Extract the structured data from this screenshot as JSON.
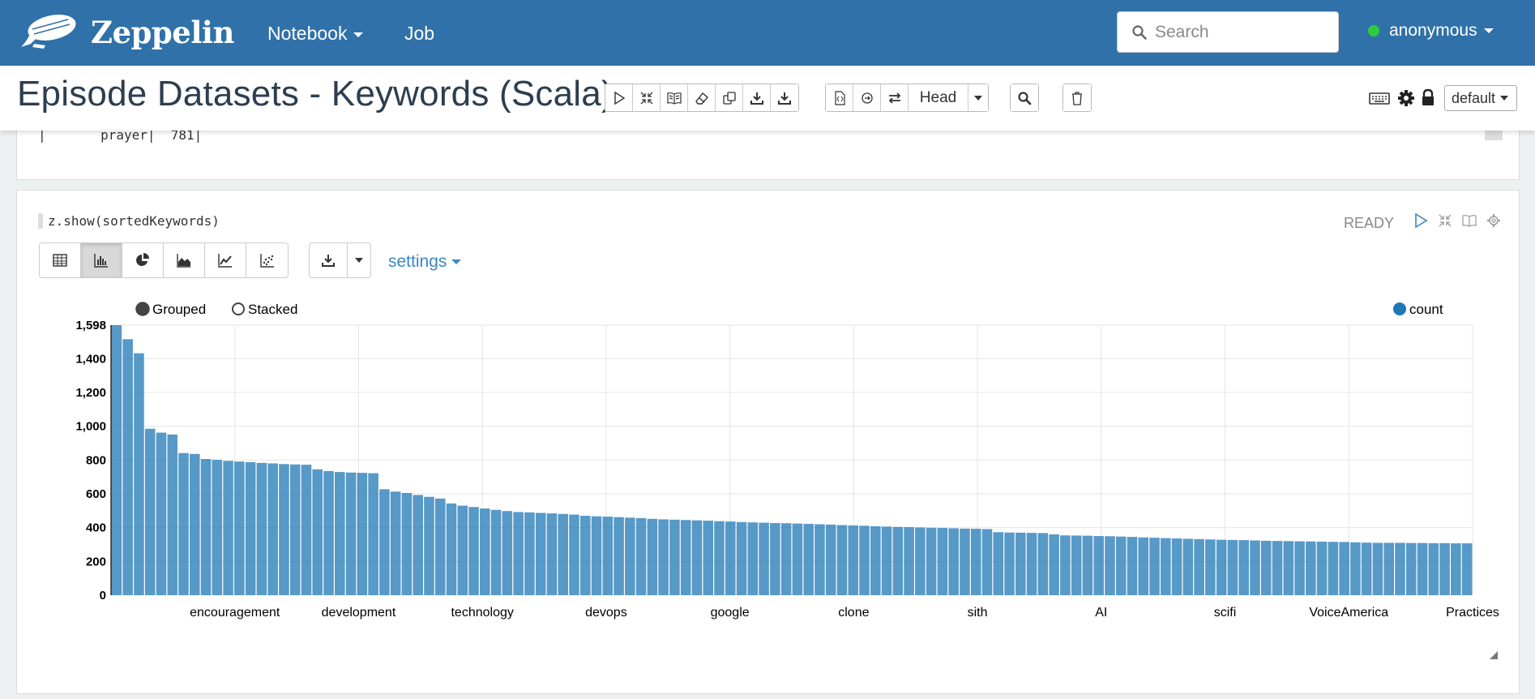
{
  "navbar": {
    "brand": "Zeppelin",
    "menu": [
      {
        "label": "Notebook",
        "dropdown": true
      },
      {
        "label": "Job",
        "dropdown": false
      }
    ],
    "search_placeholder": "Search",
    "user": "anonymous",
    "user_status_color": "#2ecc40",
    "bg_color": "#3071a9"
  },
  "note": {
    "title": "Episode Datasets - Keywords (Scala)",
    "head_label": "Head",
    "interpreter_binding": "default",
    "icons": [
      "run-all-icon",
      "collapse-icon",
      "book-icon",
      "eraser-icon",
      "clone-icon",
      "export-icon",
      "export-ipynb-icon",
      "version-control-icon",
      "commit-icon",
      "swap-icon",
      "search-icon",
      "trash-icon",
      "keyboard-icon",
      "gear-icon",
      "lock-icon"
    ]
  },
  "paragraph1": {
    "output_line": "|       prayer|  781|"
  },
  "paragraph2": {
    "code": "z.show(sortedKeywords)",
    "status": "READY",
    "viz_buttons": [
      "table-icon",
      "bar-chart-icon",
      "pie-chart-icon",
      "area-chart-icon",
      "line-chart-icon",
      "scatter-chart-icon"
    ],
    "active_viz": "bar-chart-icon",
    "settings_label": "settings"
  },
  "chart_data": {
    "type": "bar",
    "legend_modes": [
      "Grouped",
      "Stacked"
    ],
    "selected_mode": "Grouped",
    "series": [
      {
        "name": "count",
        "color": "#1f77b4",
        "values": [
          1598,
          1515,
          1432,
          985,
          962,
          951,
          841,
          836,
          806,
          801,
          795,
          791,
          787,
          783,
          780,
          776,
          774,
          772,
          745,
          735,
          729,
          726,
          724,
          722,
          627,
          613,
          605,
          593,
          582,
          572,
          543,
          530,
          522,
          513,
          505,
          498,
          492,
          490,
          487,
          484,
          481,
          477,
          470,
          467,
          465,
          462,
          459,
          456,
          452,
          449,
          447,
          445,
          443,
          441,
          438,
          436,
          433,
          431,
          429,
          427,
          426,
          424,
          422,
          420,
          418,
          415,
          413,
          411,
          408,
          406,
          404,
          403,
          401,
          399,
          398,
          396,
          394,
          393,
          391,
          373,
          371,
          370,
          369,
          368,
          360,
          354,
          353,
          352,
          350,
          349,
          347,
          345,
          342,
          340,
          338,
          336,
          334,
          332,
          330,
          328,
          327,
          326,
          324,
          322,
          321,
          320,
          319,
          318,
          317,
          316,
          315,
          313,
          311,
          310,
          310,
          310,
          309,
          309,
          308,
          308,
          307,
          307
        ]
      }
    ],
    "x_labels": [
      "encouragement",
      "development",
      "technology",
      "devops",
      "google",
      "clone",
      "sith",
      "AI",
      "scifi",
      "VoiceAmerica",
      "Practices"
    ],
    "y_ticks": [
      "0",
      "200",
      "400",
      "600",
      "800",
      "1,000",
      "1,200",
      "1,400",
      "1,598"
    ],
    "ylim": [
      0,
      1598
    ],
    "grid": true,
    "legend_position": "top-right"
  }
}
